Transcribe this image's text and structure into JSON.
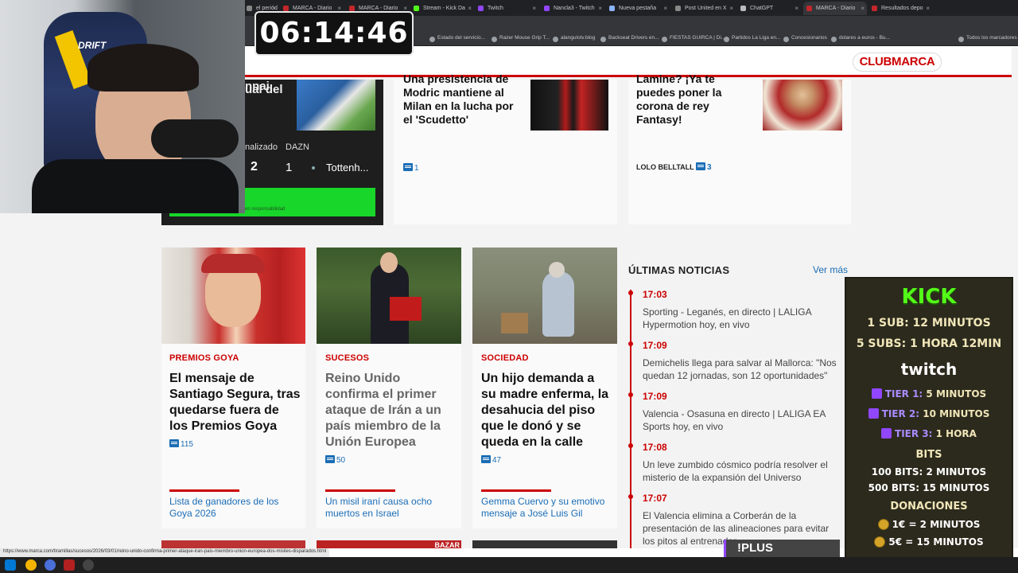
{
  "browser": {
    "tabs": [
      {
        "label": "el periód",
        "color": "#888888"
      },
      {
        "label": "MARCA - Diario",
        "color": "#c3272b"
      },
      {
        "label": "MARCA - Diario",
        "color": "#c3272b"
      },
      {
        "label": "Stream - Kick Da",
        "color": "#53fc18"
      },
      {
        "label": "Twitch",
        "color": "#9146ff"
      },
      {
        "label": "Nancla3 - Twitch",
        "color": "#9146ff"
      },
      {
        "label": "Nueva pestaña",
        "color": "#8ab4f8"
      },
      {
        "label": "Post United en X",
        "color": "#888888"
      },
      {
        "label": "ChatGPT",
        "color": "#bbbbbb"
      },
      {
        "label": "MARCA - Diario",
        "color": "#c3272b"
      },
      {
        "label": "Resultados depo",
        "color": "#c3272b"
      }
    ],
    "bookmarks": [
      "Estado del servicio...",
      "Razer Mouse Grip T...",
      "alangulotv.blog",
      "Backseat Drivers en...",
      "FIESTAS GUIRCA | Di...",
      "Partidos La Liga en...",
      "Concesionarios",
      "dolares a euros - Bu..."
    ],
    "all_bookmarks": "Todos los marcadores",
    "status_url": "https://www.marca.com/tiramillas/sucesos/2026/03/01/reino-unido-confirma-primer-ataque-iran-pais-miembro-union-europea-dos-misiles-disparados.html"
  },
  "stream": {
    "timer": "06:14:46",
    "webcam_brand": "DRIFT"
  },
  "site": {
    "club_marca": "CLUBMARCA"
  },
  "top_cards": [
    {
      "headline_fragment": "ual del",
      "headline_fragment2": "nnai,"
    },
    {
      "headline": "Una presistencia de Modric mantiene al Milan en la lucha por el 'Scudetto'",
      "comments": "1"
    },
    {
      "headline": "Lamine? ¡Ya te puedes poner la corona de rey Fantasy!",
      "author": "LOLO BELLTALL",
      "comments": "3"
    }
  ],
  "score_widget": {
    "status": "nalizado",
    "channel": "DAZN",
    "home_score": "2",
    "away_score": "1",
    "away_team": "Tottenh...",
    "disclaimer": "en responsabilidad"
  },
  "articles": [
    {
      "category": "PREMIOS GOYA",
      "headline": "El mensaje de Santiago Segura, tras quedarse fuera de los Premios Goya",
      "comments": "115",
      "related": "Lista de ganadores de los Goya 2026"
    },
    {
      "category": "SUCESOS",
      "headline": "Reino Unido confirma el primer ataque de Irán a un país miembro de la Unión Europea",
      "comments": "50",
      "related": "Un misil iraní causa ocho muertos en Israel"
    },
    {
      "category": "SOCIEDAD",
      "headline": "Un hijo demanda a su madre enferma, la desahucia del piso que le donó y se queda en la calle",
      "comments": "47",
      "related": "Gemma Cuervo y su emotivo mensaje a José Luis Gil"
    }
  ],
  "news": {
    "title": "ÚLTIMAS NOTICIAS",
    "ver_mas": "Ver más",
    "items": [
      {
        "time": "17:03",
        "text": "Sporting - Leganés, en directo | LALIGA Hypermotion hoy, en vivo"
      },
      {
        "time": "17:09",
        "text": "Demichelis llega para salvar al Mallorca: \"Nos quedan 12 jornadas, son 12 oportunidades\""
      },
      {
        "time": "17:09",
        "text": "Valencia - Osasuna en directo | LALIGA EA Sports hoy, en vivo"
      },
      {
        "time": "17:08",
        "text": "Un leve zumbido cósmico podría resolver el misterio de la expansión del Universo"
      },
      {
        "time": "17:07",
        "text": "El Valencia elimina a Corberán de la presentación de las alineaciones para evitar los pitos al entrenador"
      }
    ]
  },
  "bottom_tag": "BAZAR",
  "kick_overlay": {
    "title": "KICK",
    "sub1": "1 SUB: 12 MINUTOS",
    "sub5": "5 SUBS: 1 HORA 12MIN",
    "twitch": "twitch",
    "tier1_label": "TIER 1:",
    "tier1_value": "5 MINUTOS",
    "tier2_label": "TIER 2:",
    "tier2_value": "10 MINUTOS",
    "tier3_label": "TIER 3:",
    "tier3_value": "1 HORA",
    "bits_title": "BITS",
    "bits100": "100 BITS: 2 MINUTOS",
    "bits500": "500 BITS: 15 MINUTOS",
    "donaciones": "DONACIONES",
    "don1": "1€ = 2 MINUTOS",
    "don5": "5€ = 15 MINUTOS",
    "plus": "!PLUS"
  }
}
